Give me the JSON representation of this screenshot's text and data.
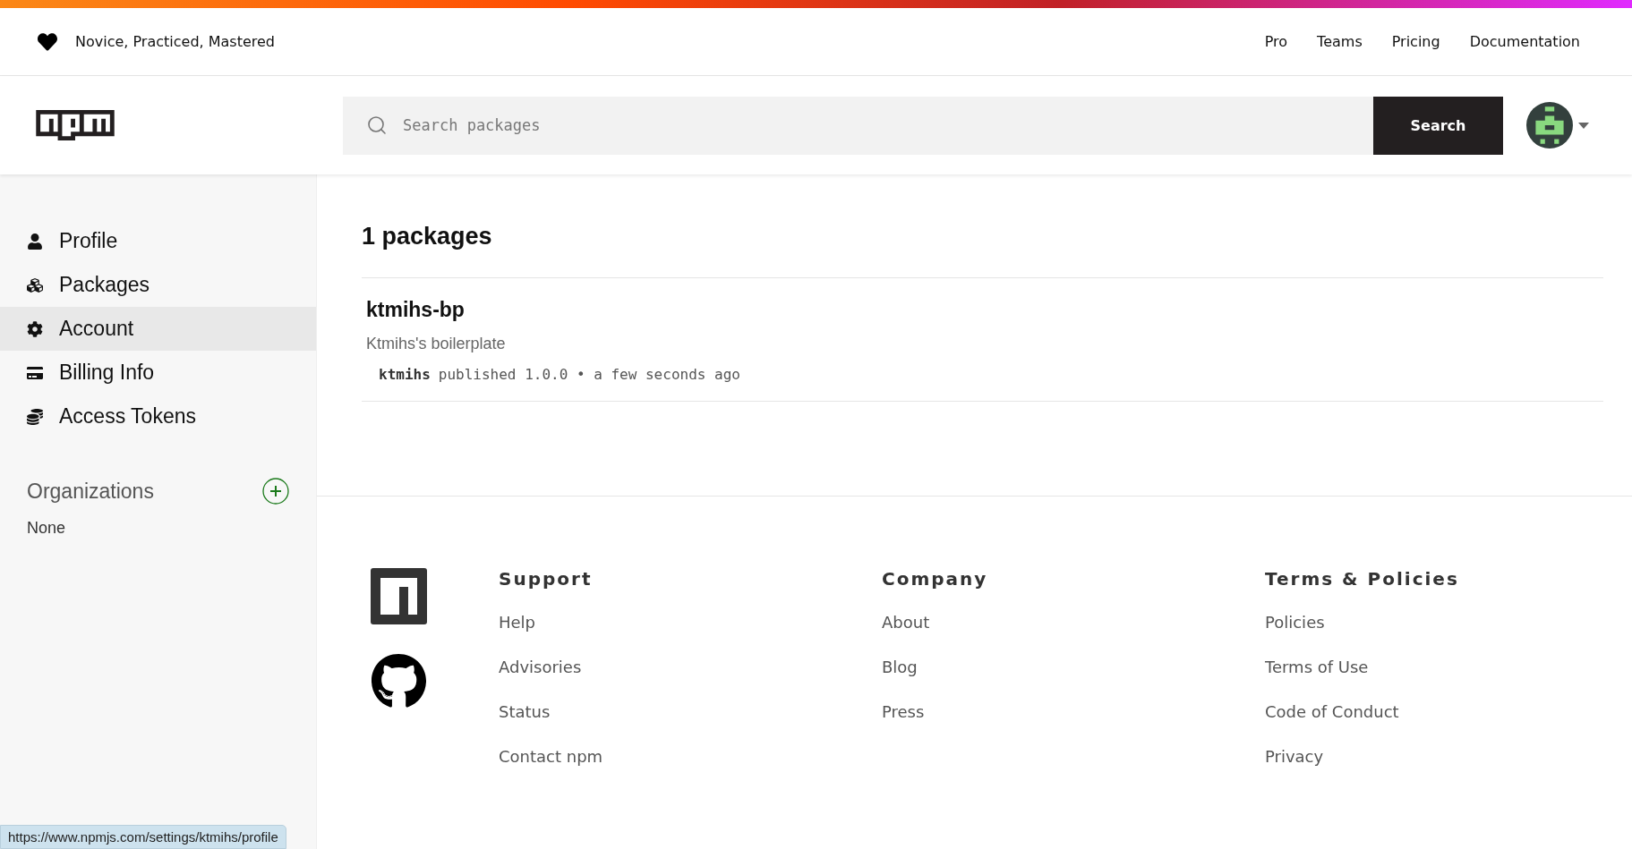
{
  "top_bar": {
    "tagline": "Novice, Practiced, Mastered",
    "links": [
      "Pro",
      "Teams",
      "Pricing",
      "Documentation"
    ]
  },
  "header": {
    "search": {
      "placeholder": "Search packages"
    },
    "search_button": "Search"
  },
  "sidebar": {
    "items": [
      {
        "label": "Profile",
        "selected": false
      },
      {
        "label": "Packages",
        "selected": false
      },
      {
        "label": "Account",
        "selected": true
      },
      {
        "label": "Billing Info",
        "selected": false
      },
      {
        "label": "Access Tokens",
        "selected": false
      }
    ],
    "organizations": {
      "title": "Organizations",
      "items": [
        "None"
      ]
    }
  },
  "main": {
    "heading": "1 packages",
    "packages": [
      {
        "name": "ktmihs-bp",
        "description": "Ktmihs's boilerplate",
        "publisher": "ktmihs",
        "meta": "published 1.0.0 • a few seconds ago"
      }
    ]
  },
  "footer": {
    "columns": [
      {
        "heading": "Support",
        "links": [
          "Help",
          "Advisories",
          "Status",
          "Contact npm"
        ]
      },
      {
        "heading": "Company",
        "links": [
          "About",
          "Blog",
          "Press"
        ]
      },
      {
        "heading": "Terms & Policies",
        "links": [
          "Policies",
          "Terms of Use",
          "Code of Conduct",
          "Privacy"
        ]
      }
    ]
  },
  "status_url": "https://www.npmjs.com/settings/ktmihs/profile"
}
